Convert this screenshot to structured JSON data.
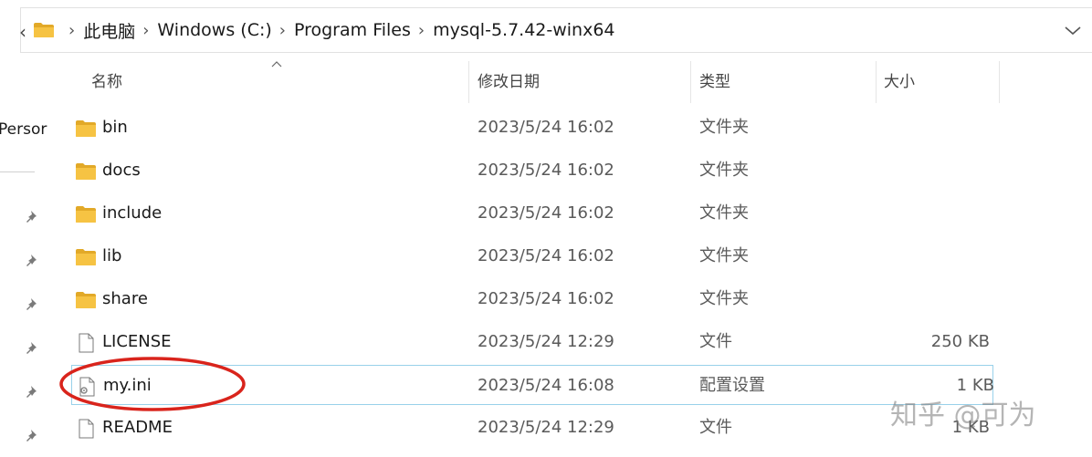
{
  "address_bar": {
    "breadcrumbs": [
      "此电脑",
      "Windows (C:)",
      "Program Files",
      "mysql-5.7.42-winx64"
    ]
  },
  "nav": {
    "person_label": "Persor"
  },
  "columns": {
    "name": "名称",
    "date": "修改日期",
    "type": "类型",
    "size": "大小"
  },
  "files": [
    {
      "name": "bin",
      "date": "2023/5/24 16:02",
      "type": "文件夹",
      "size": "",
      "icon": "folder-icon"
    },
    {
      "name": "docs",
      "date": "2023/5/24 16:02",
      "type": "文件夹",
      "size": "",
      "icon": "folder-icon"
    },
    {
      "name": "include",
      "date": "2023/5/24 16:02",
      "type": "文件夹",
      "size": "",
      "icon": "folder-icon"
    },
    {
      "name": "lib",
      "date": "2023/5/24 16:02",
      "type": "文件夹",
      "size": "",
      "icon": "folder-icon"
    },
    {
      "name": "share",
      "date": "2023/5/24 16:02",
      "type": "文件夹",
      "size": "",
      "icon": "folder-icon"
    },
    {
      "name": "LICENSE",
      "date": "2023/5/24 12:29",
      "type": "文件",
      "size": "250 KB",
      "icon": "file-icon"
    },
    {
      "name": "my.ini",
      "date": "2023/5/24 16:08",
      "type": "配置设置",
      "size": "1 KB",
      "icon": "config-file-icon"
    },
    {
      "name": "README",
      "date": "2023/5/24 12:29",
      "type": "文件",
      "size": "1 KB",
      "icon": "file-icon"
    }
  ],
  "watermark": "知乎 @可为",
  "colors": {
    "folder": "#f6c343",
    "folder_dark": "#e2a928",
    "highlight_border": "#99d1ea",
    "annotation": "#d9241c"
  }
}
